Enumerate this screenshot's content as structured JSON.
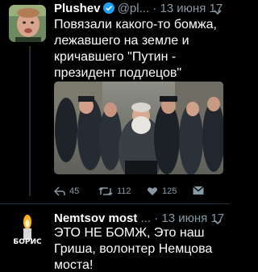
{
  "tweets": [
    {
      "name": "Plushev",
      "handle": "@pl...",
      "separator": "·",
      "date": "13 июня 17",
      "text_lines": [
        "Повязали какого-то бомжа,",
        "лежавшего на земле и",
        "кричавшего \"Путин -",
        "президент подлецов\""
      ],
      "actions": {
        "reply_count": "45",
        "retweet_count": "112",
        "like_count": "125"
      }
    },
    {
      "name": "Nemtsov most",
      "handle": "...",
      "separator": "·",
      "date": "13 июня 17",
      "avatar_text": "БОРИС",
      "text_lines": [
        "ЭТО НЕ БОМЖ, Это наш",
        "Гриша, волонтер Немцова",
        "моста!"
      ]
    }
  ],
  "colors": {
    "background": "#000000",
    "text": "#ffffff",
    "secondary": "#8899a6",
    "verified": "#1da1f2"
  }
}
